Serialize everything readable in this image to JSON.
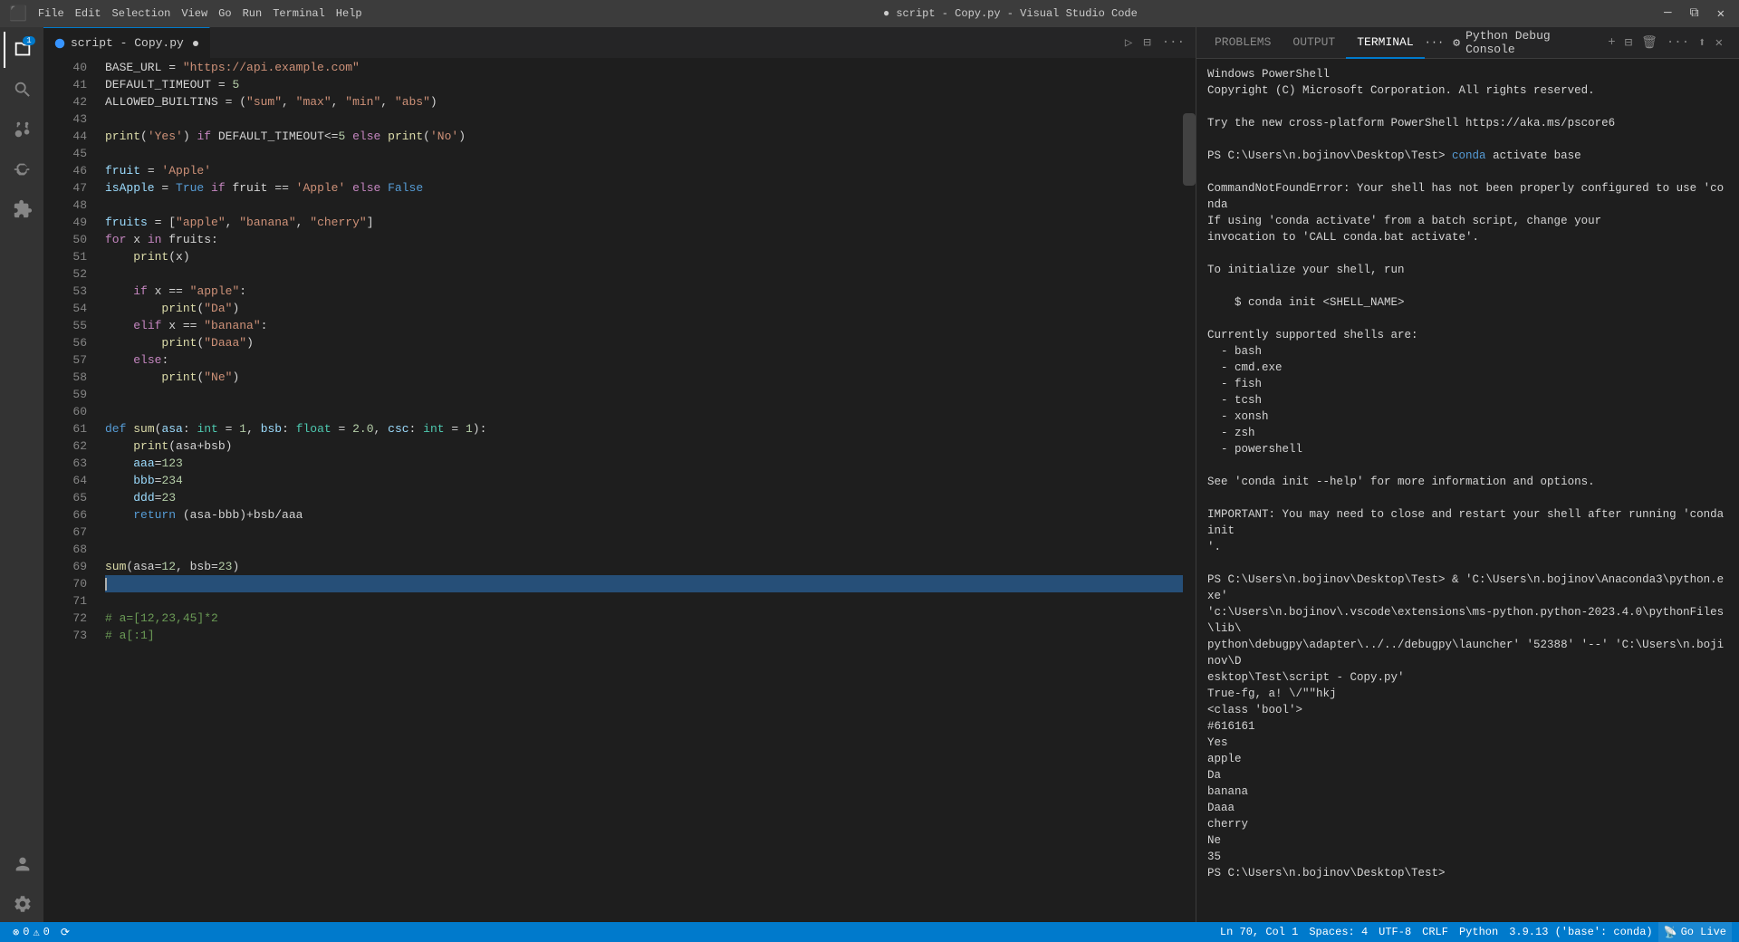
{
  "titlebar": {
    "menus": [
      "File",
      "Edit",
      "Selection",
      "View",
      "Go",
      "Run",
      "Terminal",
      "Help"
    ],
    "title": "● script - Copy.py - Visual Studio Code",
    "vscode_icon": "⬛",
    "win_minimize": "─",
    "win_restore": "⧉",
    "win_close": "✕"
  },
  "activity_bar": {
    "icons": [
      {
        "name": "explorer-icon",
        "symbol": "⎘",
        "active": true,
        "badge": "1"
      },
      {
        "name": "search-icon",
        "symbol": "🔍",
        "active": false
      },
      {
        "name": "source-control-icon",
        "symbol": "⑂",
        "active": false
      },
      {
        "name": "run-debug-icon",
        "symbol": "▷",
        "active": false
      },
      {
        "name": "extensions-icon",
        "symbol": "⊞",
        "active": false
      }
    ],
    "bottom_icons": [
      {
        "name": "account-icon",
        "symbol": "👤"
      },
      {
        "name": "settings-icon",
        "symbol": "⚙"
      }
    ]
  },
  "editor": {
    "tab_filename": "script - Copy.py",
    "tab_modified": true,
    "lines": [
      {
        "num": 40,
        "content": "BASE_URL = \"https://api.example.com\"",
        "tokens": [
          {
            "t": "plain",
            "v": "BASE_URL = "
          },
          {
            "t": "str",
            "v": "\"https://api.example.com\""
          }
        ]
      },
      {
        "num": 41,
        "content": "DEFAULT_TIMEOUT = 5",
        "tokens": [
          {
            "t": "plain",
            "v": "DEFAULT_TIMEOUT = "
          },
          {
            "t": "num",
            "v": "5"
          }
        ]
      },
      {
        "num": 42,
        "content": "ALLOWED_BUILTINS = (\"sum\", \"max\", \"min\", \"abs\")",
        "tokens": [
          {
            "t": "plain",
            "v": "ALLOWED_BUILTINS = ("
          },
          {
            "t": "str",
            "v": "\"sum\""
          },
          {
            "t": "plain",
            "v": ", "
          },
          {
            "t": "str",
            "v": "\"max\""
          },
          {
            "t": "plain",
            "v": ", "
          },
          {
            "t": "str",
            "v": "\"min\""
          },
          {
            "t": "plain",
            "v": ", "
          },
          {
            "t": "str",
            "v": "\"abs\""
          },
          {
            "t": "plain",
            "v": ")"
          }
        ]
      },
      {
        "num": 43,
        "content": ""
      },
      {
        "num": 44,
        "content": "print('Yes') if DEFAULT_TIMEOUT<=5 else print('No')",
        "tokens": [
          {
            "t": "fn",
            "v": "print"
          },
          {
            "t": "plain",
            "v": "("
          },
          {
            "t": "str",
            "v": "'Yes'"
          },
          {
            "t": "plain",
            "v": ") "
          },
          {
            "t": "kw2",
            "v": "if"
          },
          {
            "t": "plain",
            "v": " DEFAULT_TIMEOUT<="
          },
          {
            "t": "num",
            "v": "5"
          },
          {
            "t": "plain",
            "v": " "
          },
          {
            "t": "kw2",
            "v": "else"
          },
          {
            "t": "plain",
            "v": " "
          },
          {
            "t": "fn",
            "v": "print"
          },
          {
            "t": "plain",
            "v": "("
          },
          {
            "t": "str",
            "v": "'No'"
          },
          {
            "t": "plain",
            "v": ")"
          }
        ]
      },
      {
        "num": 45,
        "content": ""
      },
      {
        "num": 46,
        "content": "fruit = 'Apple'",
        "tokens": [
          {
            "t": "var",
            "v": "fruit"
          },
          {
            "t": "plain",
            "v": " = "
          },
          {
            "t": "str",
            "v": "'Apple'"
          }
        ]
      },
      {
        "num": 47,
        "content": "isApple = True if fruit == 'Apple' else False",
        "tokens": [
          {
            "t": "var",
            "v": "isApple"
          },
          {
            "t": "plain",
            "v": " = "
          },
          {
            "t": "kw",
            "v": "True"
          },
          {
            "t": "plain",
            "v": " "
          },
          {
            "t": "kw2",
            "v": "if"
          },
          {
            "t": "plain",
            "v": " fruit == "
          },
          {
            "t": "str",
            "v": "'Apple'"
          },
          {
            "t": "plain",
            "v": " "
          },
          {
            "t": "kw2",
            "v": "else"
          },
          {
            "t": "plain",
            "v": " "
          },
          {
            "t": "kw",
            "v": "False"
          }
        ]
      },
      {
        "num": 48,
        "content": ""
      },
      {
        "num": 49,
        "content": "fruits = [\"apple\", \"banana\", \"cherry\"]",
        "tokens": [
          {
            "t": "var",
            "v": "fruits"
          },
          {
            "t": "plain",
            "v": " = ["
          },
          {
            "t": "str",
            "v": "\"apple\""
          },
          {
            "t": "plain",
            "v": ", "
          },
          {
            "t": "str",
            "v": "\"banana\""
          },
          {
            "t": "plain",
            "v": ", "
          },
          {
            "t": "str",
            "v": "\"cherry\""
          },
          {
            "t": "plain",
            "v": "]"
          }
        ]
      },
      {
        "num": 50,
        "content": "for x in fruits:",
        "tokens": [
          {
            "t": "kw2",
            "v": "for"
          },
          {
            "t": "plain",
            "v": " x "
          },
          {
            "t": "kw2",
            "v": "in"
          },
          {
            "t": "plain",
            "v": " fruits:"
          }
        ]
      },
      {
        "num": 51,
        "content": "    print(x)",
        "tokens": [
          {
            "t": "plain",
            "v": "    "
          },
          {
            "t": "fn",
            "v": "print"
          },
          {
            "t": "plain",
            "v": "(x)"
          }
        ]
      },
      {
        "num": 52,
        "content": ""
      },
      {
        "num": 53,
        "content": "    if x == \"apple\":",
        "tokens": [
          {
            "t": "plain",
            "v": "    "
          },
          {
            "t": "kw2",
            "v": "if"
          },
          {
            "t": "plain",
            "v": " x == "
          },
          {
            "t": "str",
            "v": "\"apple\""
          },
          {
            "t": "plain",
            "v": ":"
          }
        ]
      },
      {
        "num": 54,
        "content": "        print(\"Da\")",
        "tokens": [
          {
            "t": "plain",
            "v": "        "
          },
          {
            "t": "fn",
            "v": "print"
          },
          {
            "t": "plain",
            "v": "("
          },
          {
            "t": "str",
            "v": "\"Da\""
          },
          {
            "t": "plain",
            "v": ")"
          }
        ]
      },
      {
        "num": 55,
        "content": "    elif x == \"banana\":",
        "tokens": [
          {
            "t": "plain",
            "v": "    "
          },
          {
            "t": "kw2",
            "v": "elif"
          },
          {
            "t": "plain",
            "v": " x == "
          },
          {
            "t": "str",
            "v": "\"banana\""
          },
          {
            "t": "plain",
            "v": ":"
          }
        ]
      },
      {
        "num": 56,
        "content": "        print(\"Daaa\")",
        "tokens": [
          {
            "t": "plain",
            "v": "        "
          },
          {
            "t": "fn",
            "v": "print"
          },
          {
            "t": "plain",
            "v": "("
          },
          {
            "t": "str",
            "v": "\"Daaa\""
          },
          {
            "t": "plain",
            "v": ")"
          }
        ]
      },
      {
        "num": 57,
        "content": "    else:",
        "tokens": [
          {
            "t": "plain",
            "v": "    "
          },
          {
            "t": "kw2",
            "v": "else"
          },
          {
            "t": "plain",
            "v": ":"
          }
        ]
      },
      {
        "num": 58,
        "content": "        print(\"Ne\")",
        "tokens": [
          {
            "t": "plain",
            "v": "        "
          },
          {
            "t": "fn",
            "v": "print"
          },
          {
            "t": "plain",
            "v": "("
          },
          {
            "t": "str",
            "v": "\"Ne\""
          },
          {
            "t": "plain",
            "v": ")"
          }
        ]
      },
      {
        "num": 59,
        "content": ""
      },
      {
        "num": 60,
        "content": ""
      },
      {
        "num": 61,
        "content": "def sum(asa: int = 1, bsb: float = 2.0, csc: int = 1):",
        "tokens": [
          {
            "t": "kw",
            "v": "def"
          },
          {
            "t": "plain",
            "v": " "
          },
          {
            "t": "fn",
            "v": "sum"
          },
          {
            "t": "plain",
            "v": "("
          },
          {
            "t": "param",
            "v": "asa"
          },
          {
            "t": "plain",
            "v": ": "
          },
          {
            "t": "type",
            "v": "int"
          },
          {
            "t": "plain",
            "v": " = "
          },
          {
            "t": "num",
            "v": "1"
          },
          {
            "t": "plain",
            "v": ", "
          },
          {
            "t": "param",
            "v": "bsb"
          },
          {
            "t": "plain",
            "v": ": "
          },
          {
            "t": "type",
            "v": "float"
          },
          {
            "t": "plain",
            "v": " = "
          },
          {
            "t": "num",
            "v": "2.0"
          },
          {
            "t": "plain",
            "v": ", "
          },
          {
            "t": "var",
            "v": "csc"
          },
          {
            "t": "plain",
            "v": ": "
          },
          {
            "t": "type",
            "v": "int"
          },
          {
            "t": "plain",
            "v": " = "
          },
          {
            "t": "num",
            "v": "1"
          },
          {
            "t": "plain",
            "v": "):"
          }
        ]
      },
      {
        "num": 62,
        "content": "    print(asa+bsb)",
        "tokens": [
          {
            "t": "plain",
            "v": "    "
          },
          {
            "t": "fn",
            "v": "print"
          },
          {
            "t": "plain",
            "v": "(asa+bsb)"
          }
        ]
      },
      {
        "num": 63,
        "content": "    aaa=123",
        "tokens": [
          {
            "t": "plain",
            "v": "    "
          },
          {
            "t": "var",
            "v": "aaa"
          },
          {
            "t": "plain",
            "v": "="
          },
          {
            "t": "num",
            "v": "123"
          }
        ]
      },
      {
        "num": 64,
        "content": "    bbb=234",
        "tokens": [
          {
            "t": "plain",
            "v": "    "
          },
          {
            "t": "var",
            "v": "bbb"
          },
          {
            "t": "plain",
            "v": "="
          },
          {
            "t": "num",
            "v": "234"
          }
        ]
      },
      {
        "num": 65,
        "content": "    ddd=23",
        "tokens": [
          {
            "t": "plain",
            "v": "    "
          },
          {
            "t": "var",
            "v": "ddd"
          },
          {
            "t": "plain",
            "v": "="
          },
          {
            "t": "num",
            "v": "23"
          }
        ]
      },
      {
        "num": 66,
        "content": "    return (asa-bbb)+bsb/aaa",
        "tokens": [
          {
            "t": "plain",
            "v": "    "
          },
          {
            "t": "kw",
            "v": "return"
          },
          {
            "t": "plain",
            "v": " (asa-bbb)+bsb/aaa"
          }
        ]
      },
      {
        "num": 67,
        "content": ""
      },
      {
        "num": 68,
        "content": ""
      },
      {
        "num": 69,
        "content": "sum(asa=12, bsb=23)",
        "tokens": [
          {
            "t": "fn",
            "v": "sum"
          },
          {
            "t": "plain",
            "v": "(asa="
          },
          {
            "t": "num",
            "v": "12"
          },
          {
            "t": "plain",
            "v": ", bsb="
          },
          {
            "t": "num",
            "v": "23"
          },
          {
            "t": "plain",
            "v": ")"
          }
        ]
      },
      {
        "num": 70,
        "content": "",
        "cursor": true
      },
      {
        "num": 71,
        "content": ""
      },
      {
        "num": 72,
        "content": "# a=[12,23,45]*2",
        "tokens": [
          {
            "t": "comment",
            "v": "# a=[12,23,45]*2"
          }
        ]
      },
      {
        "num": 73,
        "content": "# a[:1]",
        "tokens": [
          {
            "t": "comment",
            "v": "# a[:1]"
          }
        ]
      }
    ]
  },
  "terminal": {
    "tabs": [
      {
        "label": "PROBLEMS",
        "active": false
      },
      {
        "label": "OUTPUT",
        "active": false
      },
      {
        "label": "TERMINAL",
        "active": true
      }
    ],
    "debug_console": "Python Debug Console",
    "content": [
      {
        "text": "Windows PowerShell",
        "class": "term-output"
      },
      {
        "text": "Copyright (C) Microsoft Corporation. All rights reserved.",
        "class": "term-output"
      },
      {
        "text": "",
        "class": "term-output"
      },
      {
        "text": "Try the new cross-platform PowerShell https://aka.ms/pscore6",
        "class": "term-output"
      },
      {
        "text": "",
        "class": "term-output"
      },
      {
        "text": "PS C:\\Users\\n.bojinov\\Desktop\\Test> conda activate base",
        "class": "term-output",
        "has_cmd": true
      },
      {
        "text": "",
        "class": "term-output"
      },
      {
        "text": "CommandNotFoundError: Your shell has not been properly configured to use 'conda",
        "class": "term-output"
      },
      {
        "text": "If using 'conda activate' from a batch script, change your",
        "class": "term-output"
      },
      {
        "text": "invocation to 'CALL conda.bat activate'.",
        "class": "term-output"
      },
      {
        "text": "",
        "class": "term-output"
      },
      {
        "text": "To initialize your shell, run",
        "class": "term-output"
      },
      {
        "text": "",
        "class": "term-output"
      },
      {
        "text": "    $ conda init <SHELL_NAME>",
        "class": "term-output"
      },
      {
        "text": "",
        "class": "term-output"
      },
      {
        "text": "Currently supported shells are:",
        "class": "term-output"
      },
      {
        "text": "  - bash",
        "class": "term-output"
      },
      {
        "text": "  - cmd.exe",
        "class": "term-output"
      },
      {
        "text": "  - fish",
        "class": "term-output"
      },
      {
        "text": "  - tcsh",
        "class": "term-output"
      },
      {
        "text": "  - xonsh",
        "class": "term-output"
      },
      {
        "text": "  - zsh",
        "class": "term-output"
      },
      {
        "text": "  - powershell",
        "class": "term-output"
      },
      {
        "text": "",
        "class": "term-output"
      },
      {
        "text": "See 'conda init --help' for more information and options.",
        "class": "term-output"
      },
      {
        "text": "",
        "class": "term-output"
      },
      {
        "text": "IMPORTANT: You may need to close and restart your shell after running 'conda init",
        "class": "term-output"
      },
      {
        "text": "'.",
        "class": "term-output"
      },
      {
        "text": "",
        "class": "term-output"
      },
      {
        "text": "PS C:\\Users\\n.bojinov\\Desktop\\Test> & 'C:\\Users\\n.bojinov\\Anaconda3\\python.exe'",
        "class": "term-output"
      },
      {
        "text": "'c:\\Users\\n.bojinov\\.vscode\\extensions\\ms-python.python-2023.4.0\\pythonFiles\\lib\\",
        "class": "term-output"
      },
      {
        "text": "python\\debugpy\\adapter\\../../debugpy\\launcher' '52388' '--' 'C:\\Users\\n.bojinov\\D",
        "class": "term-output"
      },
      {
        "text": "esktop\\Test\\script - Copy.py'",
        "class": "term-output"
      },
      {
        "text": "True-fg, a! \\/\"\"hkj",
        "class": "term-output"
      },
      {
        "text": "<class 'bool'>",
        "class": "term-output"
      },
      {
        "text": "#616161",
        "class": "term-output"
      },
      {
        "text": "Yes",
        "class": "term-output"
      },
      {
        "text": "apple",
        "class": "term-output"
      },
      {
        "text": "Da",
        "class": "term-output"
      },
      {
        "text": "banana",
        "class": "term-output"
      },
      {
        "text": "Daaa",
        "class": "term-output"
      },
      {
        "text": "cherry",
        "class": "term-output"
      },
      {
        "text": "Ne",
        "class": "term-output"
      },
      {
        "text": "35",
        "class": "term-output"
      },
      {
        "text": "PS C:\\Users\\n.bojinov\\Desktop\\Test>",
        "class": "term-output"
      }
    ]
  },
  "statusbar": {
    "left_items": [
      {
        "icon": "⚡",
        "label": "0",
        "name": "errors"
      },
      {
        "icon": "⚠",
        "label": "0",
        "name": "warnings"
      },
      {
        "icon": "⟳",
        "label": "",
        "name": "sync"
      }
    ],
    "right_items": [
      {
        "label": "Ln 70, Col 1",
        "name": "cursor-position"
      },
      {
        "label": "Spaces: 4",
        "name": "indent"
      },
      {
        "label": "UTF-8",
        "name": "encoding"
      },
      {
        "label": "CRLF",
        "name": "line-ending"
      },
      {
        "label": "Python",
        "name": "language-mode"
      },
      {
        "label": "3.9.13 ('base': conda)",
        "name": "python-version"
      },
      {
        "label": "Go Live",
        "name": "go-live"
      }
    ]
  }
}
